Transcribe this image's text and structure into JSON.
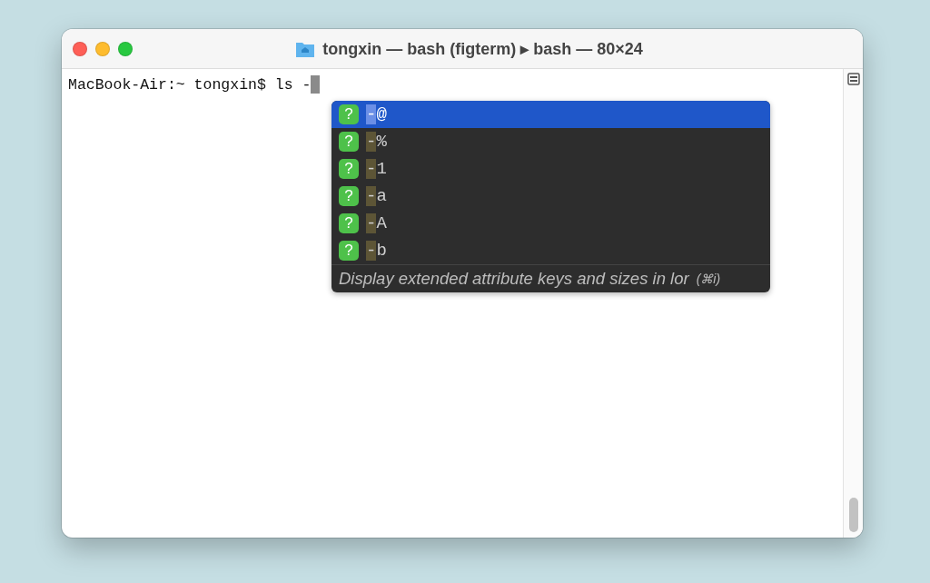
{
  "window": {
    "title": "tongxin — bash (figterm) ▸ bash — 80×24"
  },
  "terminal": {
    "prompt": "MacBook-Air:~ tongxin$ ls -"
  },
  "autocomplete": {
    "items": [
      {
        "badge": "?",
        "match": "-",
        "rest": "@",
        "selected": true
      },
      {
        "badge": "?",
        "match": "-",
        "rest": "%",
        "selected": false
      },
      {
        "badge": "?",
        "match": "-",
        "rest": "1",
        "selected": false
      },
      {
        "badge": "?",
        "match": "-",
        "rest": "a",
        "selected": false
      },
      {
        "badge": "?",
        "match": "-",
        "rest": "A",
        "selected": false
      },
      {
        "badge": "?",
        "match": "-",
        "rest": "b",
        "selected": false
      }
    ],
    "description": "Display extended attribute keys and sizes in lor",
    "shortcut": "(⌘i)"
  }
}
